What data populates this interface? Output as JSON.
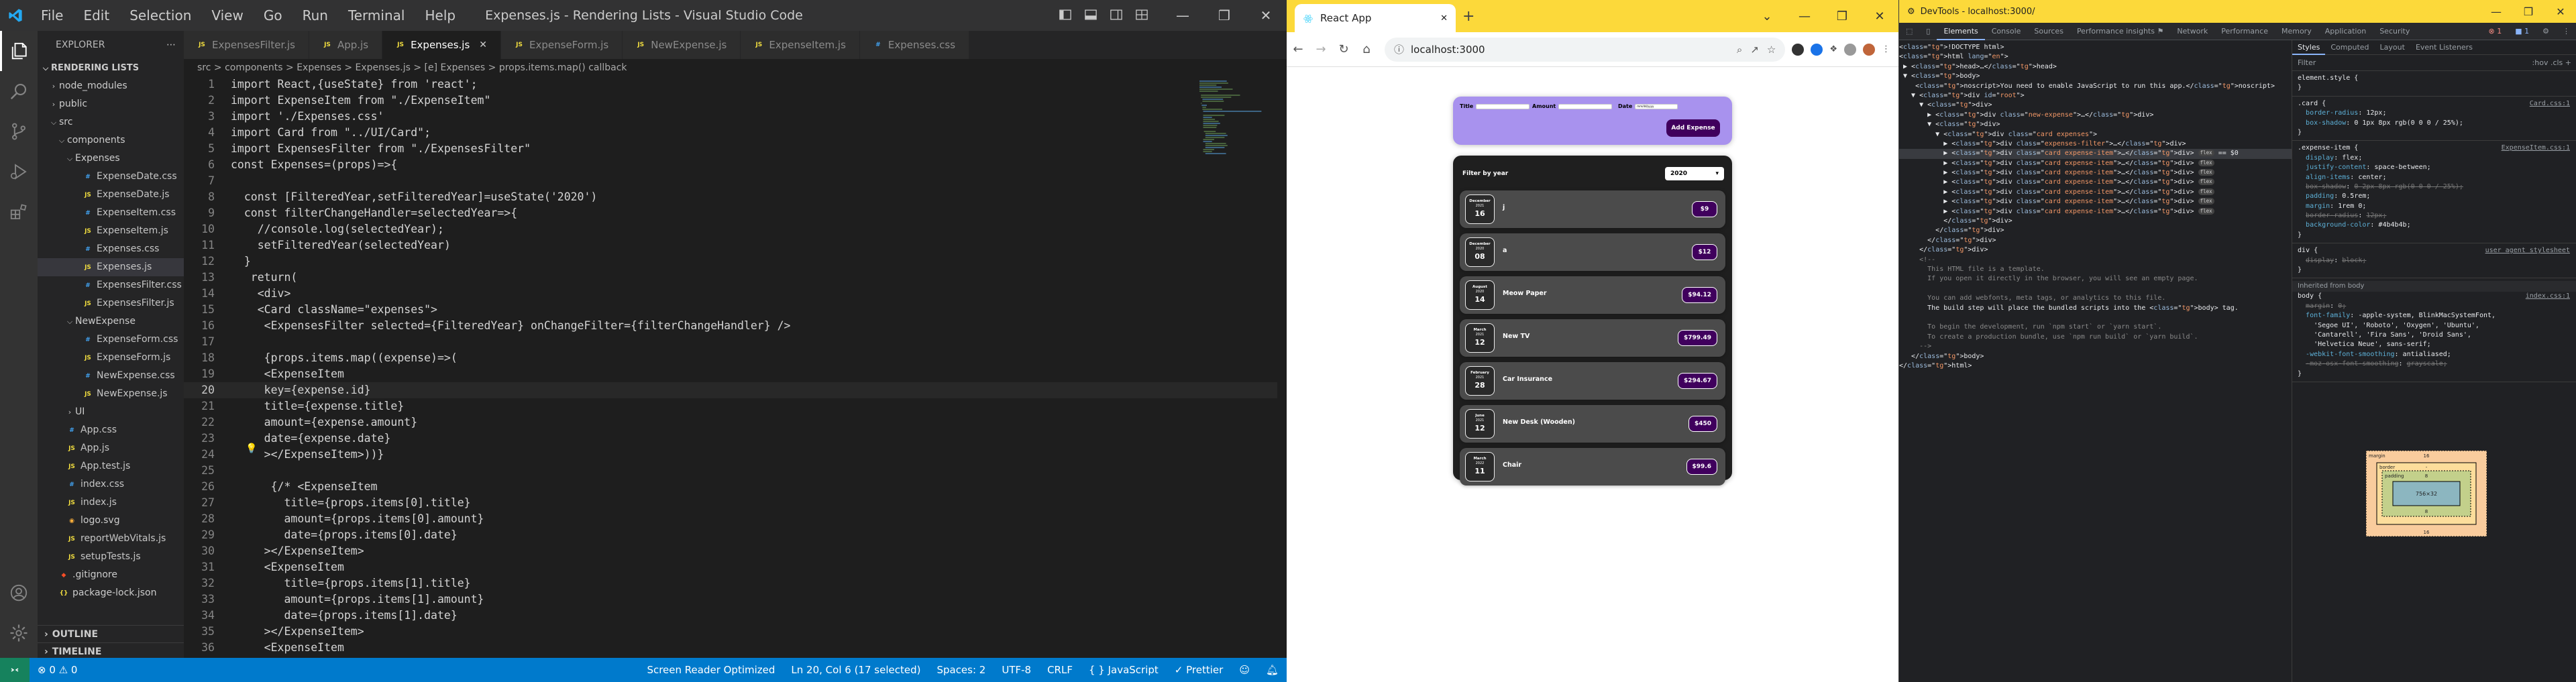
{
  "vscode": {
    "title": "Expenses.js - Rendering Lists - Visual Studio Code",
    "menu": [
      "File",
      "Edit",
      "Selection",
      "View",
      "Go",
      "Run",
      "Terminal",
      "Help"
    ],
    "explorer_title": "EXPLORER",
    "project": "RENDERING LISTS",
    "tree": [
      {
        "label": "node_modules",
        "depth": 1,
        "kind": "folder",
        "open": false
      },
      {
        "label": "public",
        "depth": 1,
        "kind": "folder",
        "open": false
      },
      {
        "label": "src",
        "depth": 1,
        "kind": "folder",
        "open": true
      },
      {
        "label": "components",
        "depth": 2,
        "kind": "folder",
        "open": true
      },
      {
        "label": "Expenses",
        "depth": 3,
        "kind": "folder",
        "open": true
      },
      {
        "label": "ExpenseDate.css",
        "depth": 4,
        "kind": "css"
      },
      {
        "label": "ExpenseDate.js",
        "depth": 4,
        "kind": "js"
      },
      {
        "label": "ExpenseItem.css",
        "depth": 4,
        "kind": "css"
      },
      {
        "label": "ExpenseItem.js",
        "depth": 4,
        "kind": "js"
      },
      {
        "label": "Expenses.css",
        "depth": 4,
        "kind": "css"
      },
      {
        "label": "Expenses.js",
        "depth": 4,
        "kind": "js",
        "selected": true
      },
      {
        "label": "ExpensesFilter.css",
        "depth": 4,
        "kind": "css"
      },
      {
        "label": "ExpensesFilter.js",
        "depth": 4,
        "kind": "js"
      },
      {
        "label": "NewExpense",
        "depth": 3,
        "kind": "folder",
        "open": true
      },
      {
        "label": "ExpenseForm.css",
        "depth": 4,
        "kind": "css"
      },
      {
        "label": "ExpenseForm.js",
        "depth": 4,
        "kind": "js"
      },
      {
        "label": "NewExpense.css",
        "depth": 4,
        "kind": "css"
      },
      {
        "label": "NewExpense.js",
        "depth": 4,
        "kind": "js"
      },
      {
        "label": "UI",
        "depth": 3,
        "kind": "folder",
        "open": false
      },
      {
        "label": "App.css",
        "depth": 2,
        "kind": "css"
      },
      {
        "label": "App.js",
        "depth": 2,
        "kind": "js"
      },
      {
        "label": "App.test.js",
        "depth": 2,
        "kind": "js"
      },
      {
        "label": "index.css",
        "depth": 2,
        "kind": "css"
      },
      {
        "label": "index.js",
        "depth": 2,
        "kind": "js"
      },
      {
        "label": "logo.svg",
        "depth": 2,
        "kind": "svg"
      },
      {
        "label": "reportWebVitals.js",
        "depth": 2,
        "kind": "js"
      },
      {
        "label": "setupTests.js",
        "depth": 2,
        "kind": "js"
      },
      {
        "label": ".gitignore",
        "depth": 1,
        "kind": "git"
      },
      {
        "label": "package-lock.json",
        "depth": 1,
        "kind": "json"
      }
    ],
    "sections": {
      "outline": "OUTLINE",
      "timeline": "TIMELINE"
    },
    "tabs": [
      {
        "label": "ExpensesFilter.js",
        "kind": "js"
      },
      {
        "label": "App.js",
        "kind": "js"
      },
      {
        "label": "Expenses.js",
        "kind": "js",
        "active": true
      },
      {
        "label": "ExpenseForm.js",
        "kind": "js"
      },
      {
        "label": "NewExpense.js",
        "kind": "js"
      },
      {
        "label": "ExpenseItem.js",
        "kind": "js"
      },
      {
        "label": "Expenses.css",
        "kind": "css"
      }
    ],
    "breadcrumb": "src > components > Expenses > Expenses.js > [e] Expenses > props.items.map() callback",
    "current_line": 20,
    "code": [
      "import React,{useState} from 'react';",
      "import ExpenseItem from \"./ExpenseItem\"",
      "import './Expenses.css'",
      "import Card from \"../UI/Card\";",
      "import ExpensesFilter from \"./ExpensesFilter\"",
      "const Expenses=(props)=>{",
      "",
      "  const [FilteredYear,setFilteredYear]=useState('2020')",
      "  const filterChangeHandler=selectedYear=>{",
      "    //console.log(selectedYear);",
      "    setFilteredYear(selectedYear)",
      "  }",
      "   return(",
      "    <div>",
      "    <Card className=\"expenses\">",
      "     <ExpensesFilter selected={FilteredYear} onChangeFilter={filterChangeHandler} />",
      "",
      "     {props.items.map((expense)=>(",
      "     <ExpenseItem",
      "     key={expense.id}",
      "     title={expense.title}",
      "     amount={expense.amount}",
      "     date={expense.date}",
      "     ></ExpenseItem>))}",
      "",
      "      {/* <ExpenseItem",
      "        title={props.items[0].title}",
      "        amount={props.items[0].amount}",
      "        date={props.items[0].date}",
      "     ></ExpenseItem>",
      "     <ExpenseItem",
      "        title={props.items[1].title}",
      "        amount={props.items[1].amount}",
      "        date={props.items[1].date}",
      "     ></ExpenseItem>",
      "     <ExpenseItem",
      "        title={props.items[1].title}"
    ],
    "status": {
      "errors": "0",
      "warnings": "0",
      "screen_reader": "Screen Reader Optimized",
      "position": "Ln 20, Col 6 (17 selected)",
      "spaces": "Spaces: 2",
      "encoding": "UTF-8",
      "eol": "CRLF",
      "language": "JavaScript",
      "formatter": "✓ Prettier"
    }
  },
  "chrome": {
    "tab_title": "React App",
    "url": "localhost:3000",
    "app": {
      "new_expense": {
        "title_label": "Title",
        "amount_label": "Amount",
        "date_label": "Date",
        "date_placeholder": "mm/dd/yyyy",
        "add_button": "Add Expense"
      },
      "filter": {
        "label": "Filter by year",
        "selected": "2020"
      },
      "expenses": [
        {
          "month": "December",
          "year": "2021",
          "day": "16",
          "title": "j",
          "amount": "$9"
        },
        {
          "month": "December",
          "year": "2020",
          "day": "08",
          "title": "a",
          "amount": "$12"
        },
        {
          "month": "August",
          "year": "2020",
          "day": "14",
          "title": "Meow Paper",
          "amount": "$94.12"
        },
        {
          "month": "March",
          "year": "2021",
          "day": "12",
          "title": "New TV",
          "amount": "$799.49"
        },
        {
          "month": "February",
          "year": "2021",
          "day": "28",
          "title": "Car Insurance",
          "amount": "$294.67"
        },
        {
          "month": "June",
          "year": "2021",
          "day": "12",
          "title": "New Desk (Wooden)",
          "amount": "$450"
        },
        {
          "month": "March",
          "year": "2022",
          "day": "11",
          "title": "Chair",
          "amount": "$99.6"
        }
      ]
    }
  },
  "devtools": {
    "title": "DevTools - localhost:3000/",
    "tabs": [
      "Elements",
      "Console",
      "Sources",
      "Performance insights ⚑",
      "Network",
      "Performance",
      "Memory",
      "Application",
      "Security"
    ],
    "active_tab": "Elements",
    "badges": {
      "issues": "1",
      "errors": "1"
    },
    "styles_tabs": [
      "Styles",
      "Computed",
      "Layout",
      "Event Listeners"
    ],
    "filter_placeholder": "Filter",
    "filter_right": ":hov .cls +",
    "dom_lines": [
      "<!DOCTYPE html>",
      "<html lang=\"en\">",
      " ▶ <head>…</head>",
      " ▼ <body>",
      "    <noscript>You need to enable JavaScript to run this app.</noscript>",
      "   ▼ <div id=\"root\">",
      "     ▼ <div>",
      "       ▶ <div class=\"new-expense\">…</div>",
      "       ▼ <div>",
      "         ▼ <div class=\"card expenses\">",
      "           ▶ <div class=\"expenses-filter\">…</div>",
      "           ▶ <div class=\"card expense-item\">…</div> [flex] == $0",
      "           ▶ <div class=\"card expense-item\">…</div> [flex]",
      "           ▶ <div class=\"card expense-item\">…</div> [flex]",
      "           ▶ <div class=\"card expense-item\">…</div> [flex]",
      "           ▶ <div class=\"card expense-item\">…</div> [flex]",
      "           ▶ <div class=\"card expense-item\">…</div> [flex]",
      "           ▶ <div class=\"card expense-item\">…</div> [flex]",
      "           </div>",
      "         </div>",
      "       </div>",
      "     </div>",
      "     <!--",
      "       This HTML file is a template.",
      "       If you open it directly in the browser, you will see an empty page.",
      "",
      "       You can add webfonts, meta tags, or analytics to this file.",
      "       The build step will place the bundled scripts into the <body> tag.",
      "",
      "       To begin the development, run `npm start` or `yarn start`.",
      "       To create a production bundle, use `npm run build` or `yarn build`.",
      "     -->",
      "   </body>",
      "</html>"
    ],
    "styles": [
      {
        "t": "sel",
        "text": "element.style {"
      },
      {
        "t": "close",
        "text": "}"
      },
      {
        "t": "sel",
        "text": ".card {",
        "src": "Card.css:1"
      },
      {
        "t": "prop",
        "p": "border-radius",
        "v": "12px;"
      },
      {
        "t": "prop",
        "p": "box-shadow",
        "v": "0 1px 8px rgb(0 0 0 / 25%);"
      },
      {
        "t": "close",
        "text": "}"
      },
      {
        "t": "sel",
        "text": ".expense-item {",
        "src": "ExpenseItem.css:1"
      },
      {
        "t": "prop",
        "p": "display",
        "v": "flex;"
      },
      {
        "t": "prop",
        "p": "justify-content",
        "v": "space-between;"
      },
      {
        "t": "prop",
        "p": "align-items",
        "v": "center;"
      },
      {
        "t": "prop",
        "p": "box-shadow",
        "v": "0 2px 8px rgb(0 0 0 / 25%);",
        "strike": true
      },
      {
        "t": "prop",
        "p": "padding",
        "v": "0.5rem;"
      },
      {
        "t": "prop",
        "p": "margin",
        "v": "1rem 0;"
      },
      {
        "t": "prop",
        "p": "border-radius",
        "v": "12px;",
        "strike": true
      },
      {
        "t": "prop",
        "p": "background-color",
        "v": "#4b4b4b;"
      },
      {
        "t": "close",
        "text": "}"
      },
      {
        "t": "sel",
        "text": "div {",
        "src": "user agent stylesheet"
      },
      {
        "t": "prop",
        "p": "display",
        "v": "block;",
        "strike": true
      },
      {
        "t": "close",
        "text": "}"
      },
      {
        "t": "inh",
        "text": "Inherited from body"
      },
      {
        "t": "sel",
        "text": "body {",
        "src": "index.css:1"
      },
      {
        "t": "prop",
        "p": "margin",
        "v": "0;",
        "strike": true
      },
      {
        "t": "prop",
        "p": "font-family",
        "v": "-apple-system, BlinkMacSystemFont,"
      },
      {
        "t": "raw",
        "text": "    'Segoe UI', 'Roboto', 'Oxygen', 'Ubuntu',"
      },
      {
        "t": "raw",
        "text": "    'Cantarell', 'Fira Sans', 'Droid Sans',"
      },
      {
        "t": "raw",
        "text": "    'Helvetica Neue', sans-serif;"
      },
      {
        "t": "prop",
        "p": "-webkit-font-smoothing",
        "v": "antialiased;"
      },
      {
        "t": "prop",
        "p": "-moz-osx-font-smoothing",
        "v": "grayscale;",
        "strike": true
      },
      {
        "t": "close",
        "text": "}"
      }
    ],
    "box_model": {
      "margin": "16",
      "border": "-",
      "padding": "8",
      "content": "756×32"
    }
  }
}
